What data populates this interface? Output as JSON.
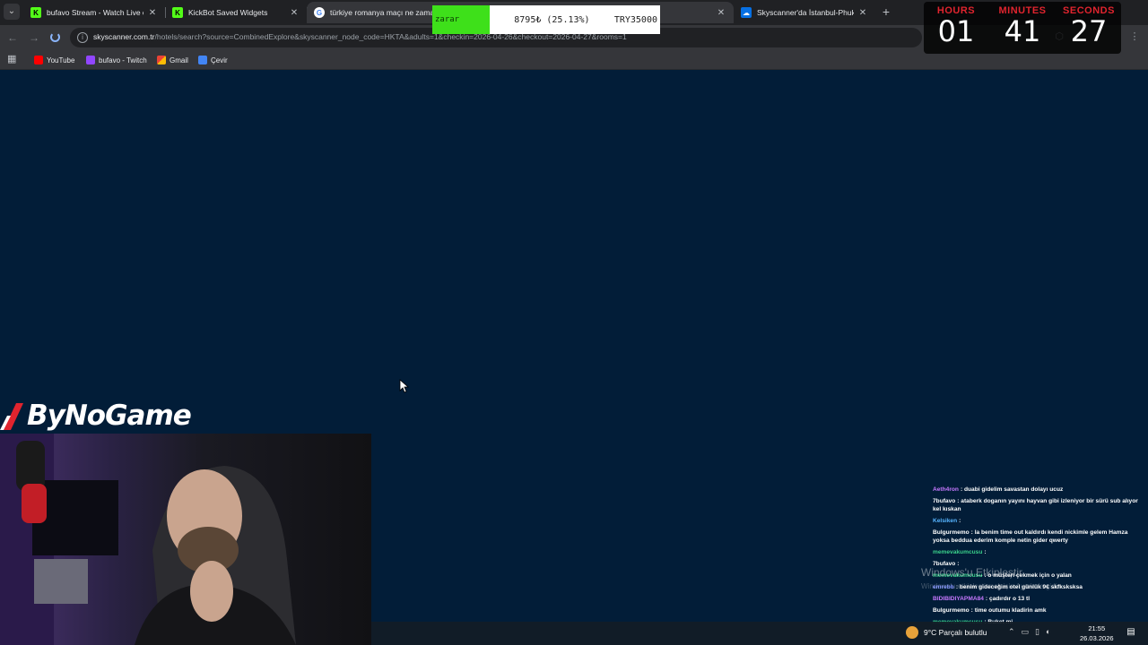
{
  "browser": {
    "tabs": [
      {
        "title": "bufavo Stream - Watch Live on",
        "favicon": "kick-icon",
        "color": "#53fc18"
      },
      {
        "title": "KickBot Saved Widgets",
        "favicon": "kickbot-icon",
        "color": "#53fc18"
      },
      {
        "title": "türkiye romanya maçı ne zaman",
        "favicon": "google-icon",
        "color": "#ffffff"
      },
      {
        "title": "Skyscanner'da İstanbul-Phuket",
        "favicon": "skyscanner-icon",
        "color": "#0770e3"
      }
    ],
    "url_host": "skyscanner.com.tr",
    "url_path": "/hotels/search?source=CombinedExplore&skyscanner_node_code=HKTA&adults=1&checkin=2026-04-26&checkout=2026-04-27&rooms=1"
  },
  "bookmarks": [
    {
      "label": "YouTube",
      "icon": "youtube-icon",
      "color": "#ff0000"
    },
    {
      "label": "bufavo - Twitch",
      "icon": "twitch-icon",
      "color": "#9146ff"
    },
    {
      "label": "Gmail",
      "icon": "gmail-icon",
      "color": "#ea4335"
    },
    {
      "label": "Çevir",
      "icon": "translate-icon",
      "color": "#4285f4"
    }
  ],
  "ticker": {
    "status": "zarar",
    "pnl": "8795₺ (25.13%)",
    "capital": "TRY35000"
  },
  "clock": {
    "hours_label": "HOURS",
    "minutes_label": "MINUTES",
    "seconds_label": "SECONDS",
    "hours": "01",
    "minutes": "41",
    "seconds": "27"
  },
  "logo": {
    "text": "ByNoGame"
  },
  "chat": [
    {
      "user": "Aeth4ron",
      "color": "#c678ff",
      "text": ": duabi gidelim savastan dolayı ucuz"
    },
    {
      "user": "7bufavo",
      "color": "#ffffff",
      "text": ": ataberk doganın yayını hayvan gibi izleniyor bir sürü sub alıyor kel kıskan"
    },
    {
      "user": "Kelsiken",
      "color": "#56b4ff",
      "text": ":"
    },
    {
      "user": "Bulgurmemo",
      "color": "#ffffff",
      "text": ": la benim time out kaldırdı kendi nickimle gelem Hamza yoksa beddua ederim komple netin gider qwerty"
    },
    {
      "user": "memevakumcusu",
      "color": "#3ad08a",
      "text": ":"
    },
    {
      "user": "7bufavo",
      "color": "#ffffff",
      "text": ":"
    },
    {
      "user": "memevakumcusu",
      "color": "#3ad08a",
      "text": ": o müşteri çekmek için o yalan"
    },
    {
      "user": "emrebb",
      "color": "#7a8cff",
      "text": ": benim gideceğim otel günlük 9€ skfksksksa"
    },
    {
      "user": "BIDIBIDIYAPMA84",
      "color": "#c678ff",
      "text": ": çadırdır o 13 tl"
    },
    {
      "user": "Bulgurmemo",
      "color": "#ffffff",
      "text": ": time outumu kladirin amk"
    },
    {
      "user": "memevakumcusu",
      "color": "#3ad08a",
      "text": ": Buket mi"
    }
  ],
  "watermark": {
    "title": "Windows'u Etkinleştir",
    "subtitle": "Windows'u etkinleştirmek için Ayarlar'a gidin."
  },
  "taskbar": {
    "weather": "9°C  Parçalı bulutlu",
    "time": "21:55",
    "date": "26.03.2026"
  }
}
